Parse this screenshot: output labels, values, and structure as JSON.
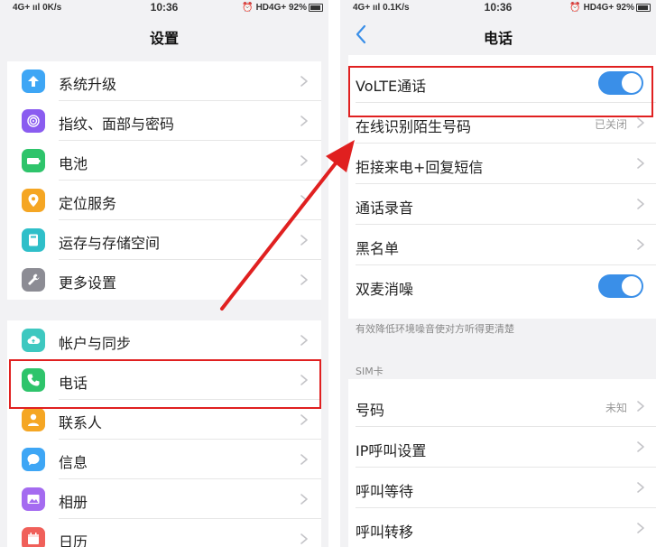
{
  "left_phone": {
    "status": {
      "network": "4G+ ııl",
      "speed": "0K/s",
      "time": "10:36",
      "icons": "⏰ HD4G+",
      "battery": "92%"
    },
    "title": "设置",
    "group1": [
      {
        "label": "系统升级",
        "icon": "system-update-icon",
        "color": "#3ea6f5"
      },
      {
        "label": "指纹、面部与密码",
        "icon": "fingerprint-icon",
        "color": "#8a5cf0"
      },
      {
        "label": "电池",
        "icon": "battery-icon",
        "color": "#2ec46b"
      },
      {
        "label": "定位服务",
        "icon": "location-pin-icon",
        "color": "#f5a623"
      },
      {
        "label": "运存与存储空间",
        "icon": "storage-icon",
        "color": "#2fbfc9"
      },
      {
        "label": "更多设置",
        "icon": "wrench-icon",
        "color": "#8c8c94"
      }
    ],
    "group2": [
      {
        "label": "帐户与同步",
        "icon": "cloud-sync-icon",
        "color": "#3ec8c0"
      },
      {
        "label": "电话",
        "icon": "phone-icon",
        "color": "#2ec46b"
      },
      {
        "label": "联系人",
        "icon": "contact-icon",
        "color": "#f5a623"
      },
      {
        "label": "信息",
        "icon": "message-icon",
        "color": "#3ea6f5"
      },
      {
        "label": "相册",
        "icon": "gallery-icon",
        "color": "#a46bf0"
      },
      {
        "label": "日历",
        "icon": "calendar-icon",
        "color": "#f0605a"
      }
    ]
  },
  "right_phone": {
    "status": {
      "network": "4G+ ııl",
      "speed": "0.1K/s",
      "time": "10:36",
      "icons": "⏰ HD4G+",
      "battery": "92%"
    },
    "title": "电话",
    "back_icon": "back-chevron-icon",
    "accent": "#3a8fe8",
    "group1": [
      {
        "label": "VoLTE通话",
        "kind": "toggle",
        "on": true
      },
      {
        "label": "在线识别陌生号码",
        "kind": "value",
        "value": "已关闭"
      },
      {
        "label": "拒接来电+回复短信",
        "kind": "link"
      },
      {
        "label": "通话录音",
        "kind": "link"
      },
      {
        "label": "黑名单",
        "kind": "link"
      },
      {
        "label": "双麦消噪",
        "kind": "toggle",
        "on": true
      }
    ],
    "hint": "有效降低环境噪音使对方听得更清楚",
    "sim_section": "SIM卡",
    "group2": [
      {
        "label": "号码",
        "kind": "value",
        "value": "未知"
      },
      {
        "label": "IP呼叫设置",
        "kind": "link"
      },
      {
        "label": "呼叫等待",
        "kind": "link"
      },
      {
        "label": "呼叫转移",
        "kind": "link"
      }
    ]
  },
  "annotation": {
    "highlight_color": "#e02020"
  }
}
